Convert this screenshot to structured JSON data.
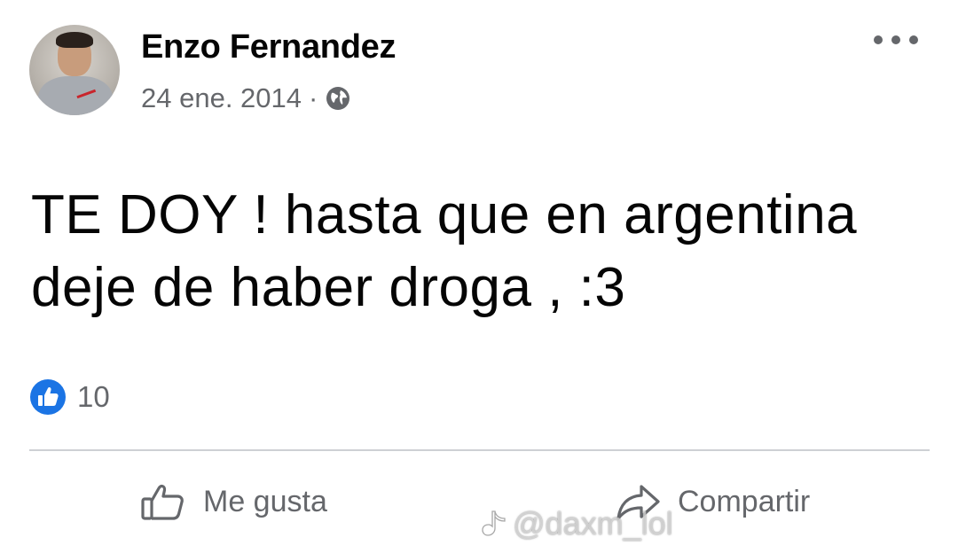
{
  "post": {
    "author": "Enzo Fernandez",
    "date": "24 ene. 2014",
    "separator": "·",
    "privacy_icon": "globe-icon",
    "text_line1": "TE DOY ! hasta que en argentina",
    "text_line2": "deje de haber droga , :3",
    "like_count": "10"
  },
  "actions": {
    "like_label": "Me gusta",
    "share_label": "Compartir"
  },
  "watermark": {
    "text": "@daxm_lol"
  },
  "colors": {
    "like_blue": "#1b74e4",
    "secondary_text": "#65676b",
    "primary_text": "#050505"
  }
}
